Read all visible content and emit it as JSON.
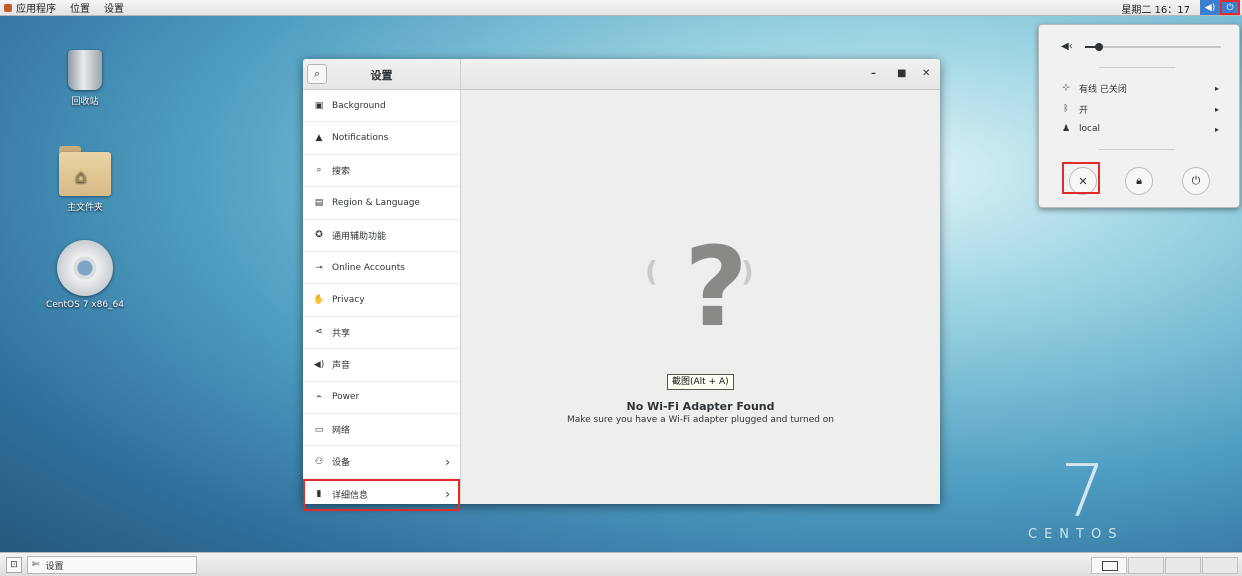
{
  "topbar": {
    "menu": [
      "应用程序",
      "位置",
      "设置"
    ],
    "clock": "星期二 16：17"
  },
  "desktop": {
    "icons": [
      {
        "label": "回收站"
      },
      {
        "label": "主文件夹"
      },
      {
        "label": "CentOS 7 x86_64"
      }
    ]
  },
  "settings_window": {
    "title": "设置",
    "sidebar": [
      {
        "label": "Background",
        "icon": "monitor-icon"
      },
      {
        "label": "Notifications",
        "icon": "bell-icon"
      },
      {
        "label": "搜索",
        "icon": "search-icon"
      },
      {
        "label": "Region & Language",
        "icon": "keyboard-icon"
      },
      {
        "label": "通用辅助功能",
        "icon": "accessibility-icon"
      },
      {
        "label": "Online Accounts",
        "icon": "online-accounts-icon"
      },
      {
        "label": "Privacy",
        "icon": "hand-icon"
      },
      {
        "label": "共享",
        "icon": "share-icon"
      },
      {
        "label": "声音",
        "icon": "speaker-icon"
      },
      {
        "label": "Power",
        "icon": "power-plug-icon"
      },
      {
        "label": "网络",
        "icon": "network-icon"
      },
      {
        "label": "设备",
        "icon": "devices-icon"
      },
      {
        "label": "详细信息",
        "icon": "info-icon"
      }
    ],
    "content": {
      "title": "No Wi-Fi Adapter Found",
      "subtitle": "Make sure you have a Wi-Fi adapter plugged and turned on"
    }
  },
  "tooltip": {
    "text": "截图(Alt + A)"
  },
  "system_menu": {
    "volume_level": 0.1,
    "rows": [
      {
        "label": "有线 已关闭",
        "icon": "wired-network-icon"
      },
      {
        "label": "开",
        "icon": "bluetooth-icon"
      },
      {
        "label": "local",
        "icon": "user-icon"
      }
    ]
  },
  "watermark": {
    "number": "7",
    "word": "CENTOS"
  },
  "taskbar": {
    "window_label": "设置"
  }
}
